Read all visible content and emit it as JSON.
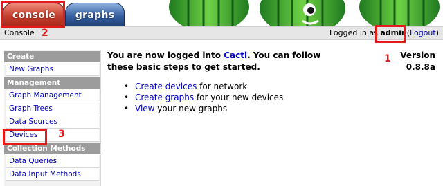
{
  "tabs": {
    "console": "console",
    "graphs": "graphs"
  },
  "header": {
    "breadcrumb": "Console",
    "logged_in_as": "Logged in as",
    "username": "admin",
    "logout_open": "(",
    "logout_label": "Logout",
    "logout_close": ")"
  },
  "sidebar": {
    "sections": [
      {
        "title": "Create",
        "items": [
          "New Graphs"
        ]
      },
      {
        "title": "Management",
        "items": [
          "Graph Management",
          "Graph Trees",
          "Data Sources",
          "Devices"
        ]
      },
      {
        "title": "Collection Methods",
        "items": [
          "Data Queries",
          "Data Input Methods"
        ]
      }
    ]
  },
  "main": {
    "intro_before": "You are now logged into ",
    "intro_link": "Cacti",
    "intro_after": ". You can follow these basic steps to get started.",
    "version_label": "Version",
    "version_number": "0.8.8a",
    "steps": [
      {
        "link": "Create devices",
        "text": " for network"
      },
      {
        "link": "Create graphs",
        "text": " for your new devices"
      },
      {
        "link": "View",
        "text": " your new graphs"
      }
    ]
  },
  "annotations": {
    "one": "1",
    "two": "2",
    "three": "3"
  },
  "colors": {
    "annotation_red": "#e31b1b",
    "console_tab": "#c43d2c",
    "graphs_tab": "#335e9e",
    "link_blue": "#0000c8",
    "sidebar_header": "#9c9c9c"
  }
}
